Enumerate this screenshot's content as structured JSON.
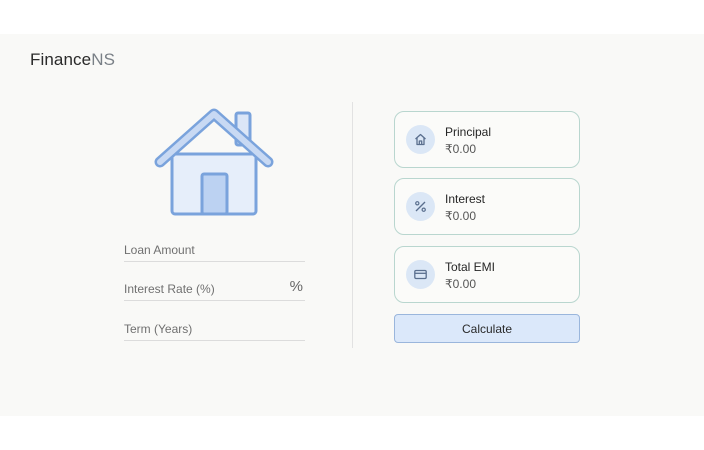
{
  "brand": {
    "part1": "Finance",
    "part2": "NS"
  },
  "form": {
    "loan_amount_label": "Loan Amount",
    "interest_rate_label": "Interest Rate (%)",
    "percent_symbol": "%",
    "term_label": "Term (Years)"
  },
  "results": {
    "principal": {
      "title": "Principal",
      "value": "₹0.00",
      "icon": "home-icon"
    },
    "interest": {
      "title": "Interest",
      "value": "₹0.00",
      "icon": "percent-icon"
    },
    "total_emi": {
      "title": "Total EMI",
      "value": "₹0.00",
      "icon": "card-icon"
    }
  },
  "calculate_label": "Calculate",
  "colors": {
    "accent_fill": "#dbe8fa",
    "accent_border": "#9ab6dc",
    "card_border": "#b9d6cf",
    "house_stroke": "#7aa3dc",
    "house_fill": "#dbe6f7"
  }
}
